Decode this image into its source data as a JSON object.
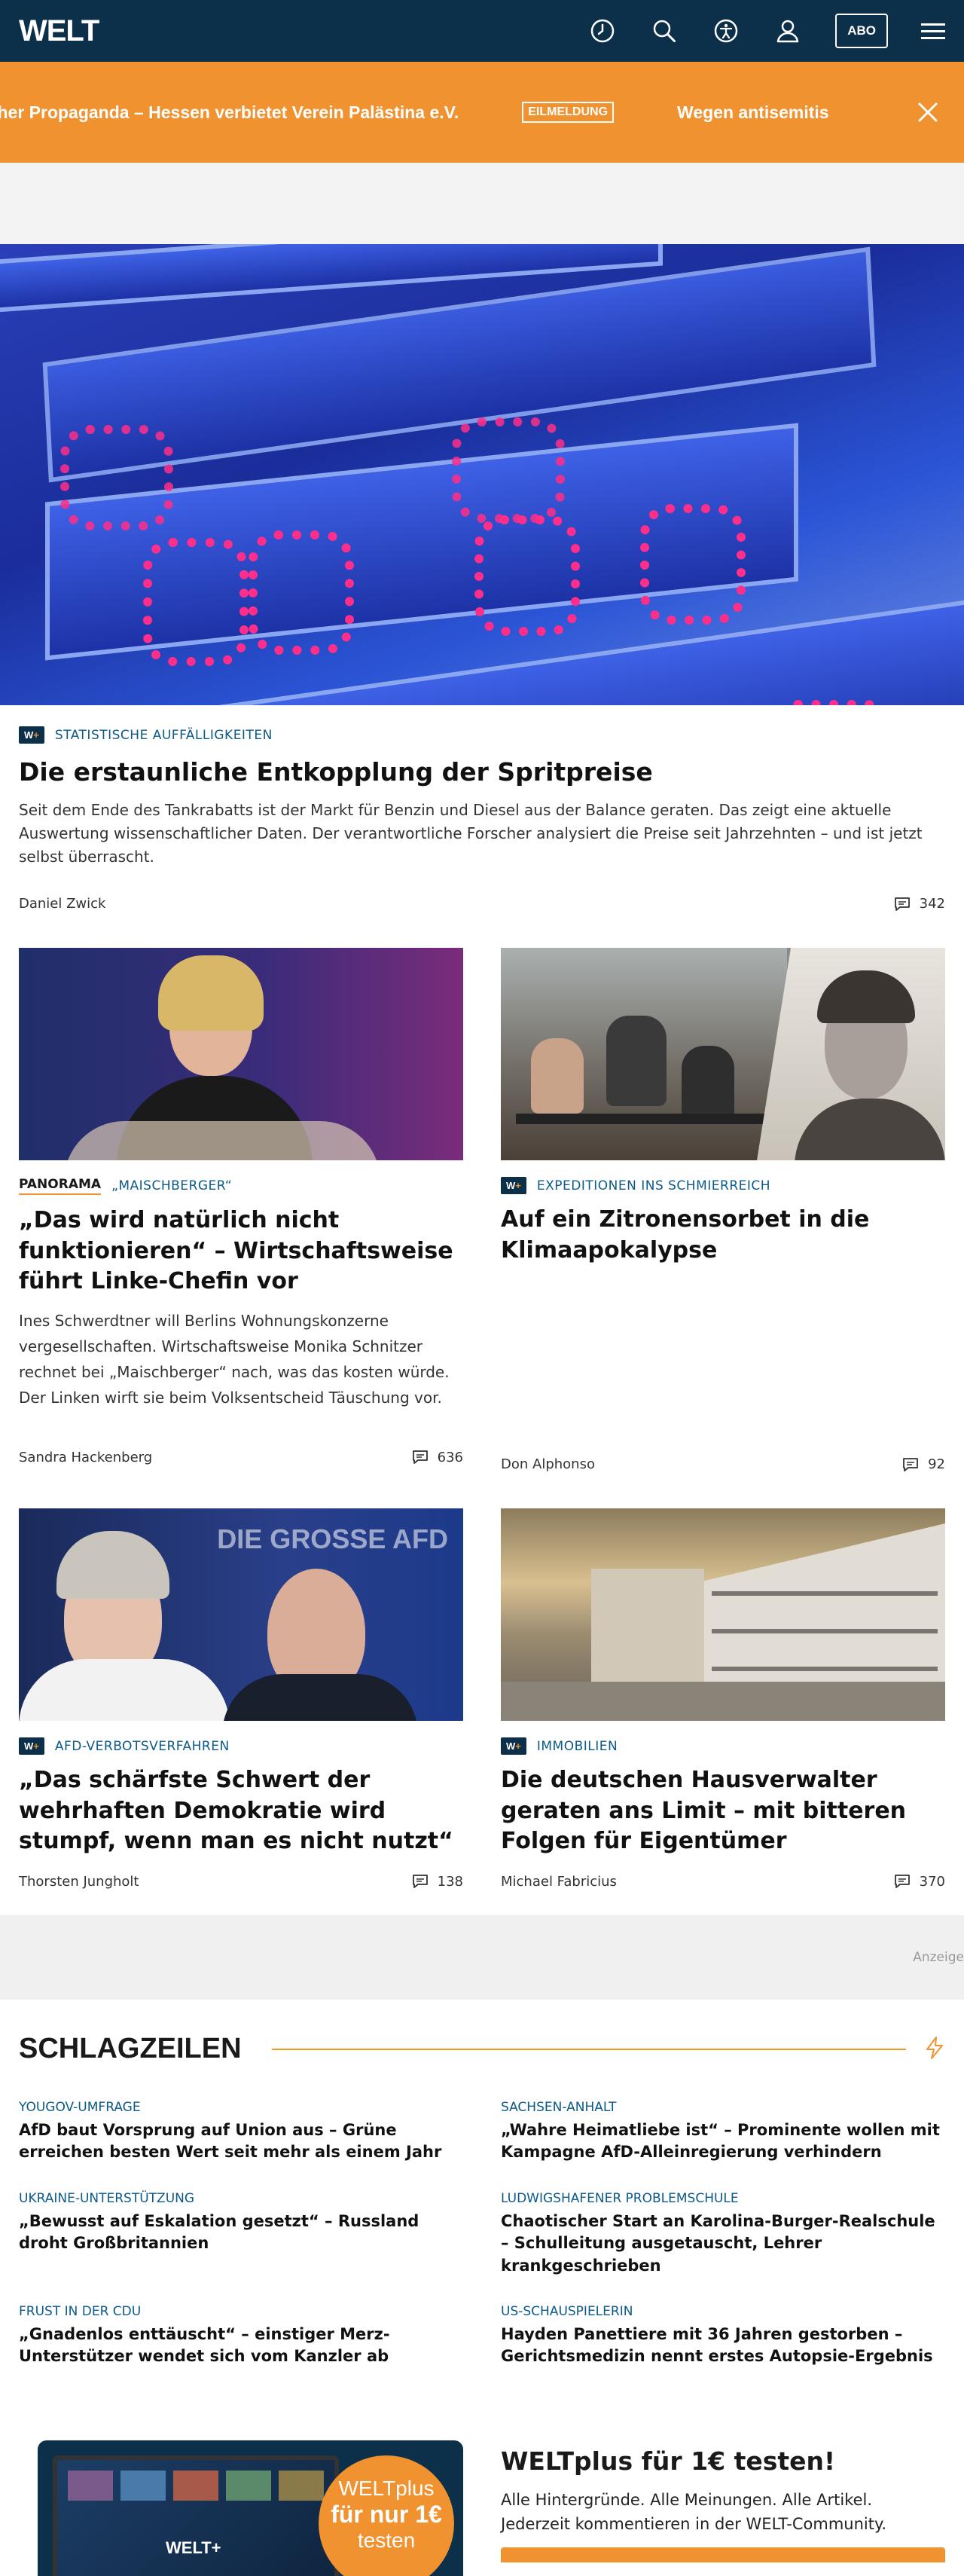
{
  "header": {
    "logo": "WELT",
    "abo_label": "ABO"
  },
  "ticker": {
    "text_1": "mitischer Propaganda – Hessen verbietet Verein Palästina e.V.",
    "badge": "EILMELDUNG",
    "text_2": "Wegen antisemitis"
  },
  "hero": {
    "badge": "W+",
    "kicker": "STATISTISCHE AUFFÄLLIGKEITEN",
    "title": "Die erstaunliche Entkopplung der Spritpreise",
    "teaser": "Seit dem Ende des Tankrabatts ist der Markt für Benzin und Diesel aus der Balance geraten. Das zeigt eine aktuelle Auswertung wissenschaftlicher Daten. Der verantwortliche Forscher analysiert die Preise seit Jahrzehnten – und ist jetzt selbst überrascht.",
    "author": "Daniel Zwick",
    "comments": "342"
  },
  "cards": [
    {
      "section": "PANORAMA",
      "kicker": "„MAISCHBERGER“",
      "title": "„Das wird natürlich nicht funktionieren“ – Wirtschaftsweise führt Linke-Chefin vor",
      "teaser": "Ines Schwerdtner will Berlins Wohnungskonzerne vergesellschaften. Wirtschaftsweise Monika Schnitzer rechnet bei „Maischberger“ nach, was das kosten würde. Der Linken wirft sie beim Volksentscheid Täuschung vor.",
      "author": "Sandra Hackenberg",
      "comments": "636"
    },
    {
      "badge": "W+",
      "kicker": "EXPEDITIONEN INS SCHMIERREICH",
      "title": "Auf ein Zitronensorbet in die Klimaapokalypse",
      "author": "Don Alphonso",
      "comments": "92"
    },
    {
      "badge": "W+",
      "kicker": "AFD-VERBOTSVERFAHREN",
      "title": "„Das schärfste Schwert der wehrhaften Demokratie wird stumpf, wenn man es nicht nutzt“",
      "author": "Thorsten Jungholt",
      "comments": "138"
    },
    {
      "badge": "W+",
      "kicker": "IMMOBILIEN",
      "title": "Die deutschen Hausverwalter geraten ans Limit – mit bitteren Folgen für Eigentümer",
      "author": "Michael Fabricius",
      "comments": "370"
    }
  ],
  "ad": {
    "label": "Anzeige"
  },
  "schlagzeilen": {
    "title": "SCHLAGZEILEN",
    "items": [
      {
        "kicker": "YOUGOV-UMFRAGE",
        "title": "AfD baut Vorsprung auf Union aus – Grüne erreichen besten Wert seit mehr als einem Jahr"
      },
      {
        "kicker": "SACHSEN-ANHALT",
        "title": "„Wahre Heimatliebe ist“ – Prominente wollen mit Kampagne AfD-Alleinregierung verhindern"
      },
      {
        "kicker": "UKRAINE-UNTERSTÜTZUNG",
        "title": "„Bewusst auf Eskalation gesetzt“ – Russland droht Großbritannien"
      },
      {
        "kicker": "LUDWIGSHAFENER PROBLEMSCHULE",
        "title": "Chaotischer Start an Karolina-Burger-Realschule – Schulleitung ausgetauscht, Lehrer krankgeschrieben"
      },
      {
        "kicker": "FRUST IN DER CDU",
        "title": "„Gnadenlos enttäuscht“ – einstiger Merz-Unterstützer wendet sich vom Kanzler ab"
      },
      {
        "kicker": "US-SCHAUSPIELERIN",
        "title": "Hayden Panettiere mit 36 Jahren gestorben – Gerichtsmedizin nennt erstes Autopsie-Ergebnis"
      }
    ]
  },
  "promo": {
    "badge_line1": "WELTplus",
    "badge_line2": "für nur 1€",
    "badge_line3": "testen",
    "tv_logo": "WELT+",
    "title": "WELTplus für 1€ testen!",
    "text": "Alle Hintergründe. Alle Meinungen. Alle Artikel. Jederzeit kommentieren in der WELT-Community."
  }
}
